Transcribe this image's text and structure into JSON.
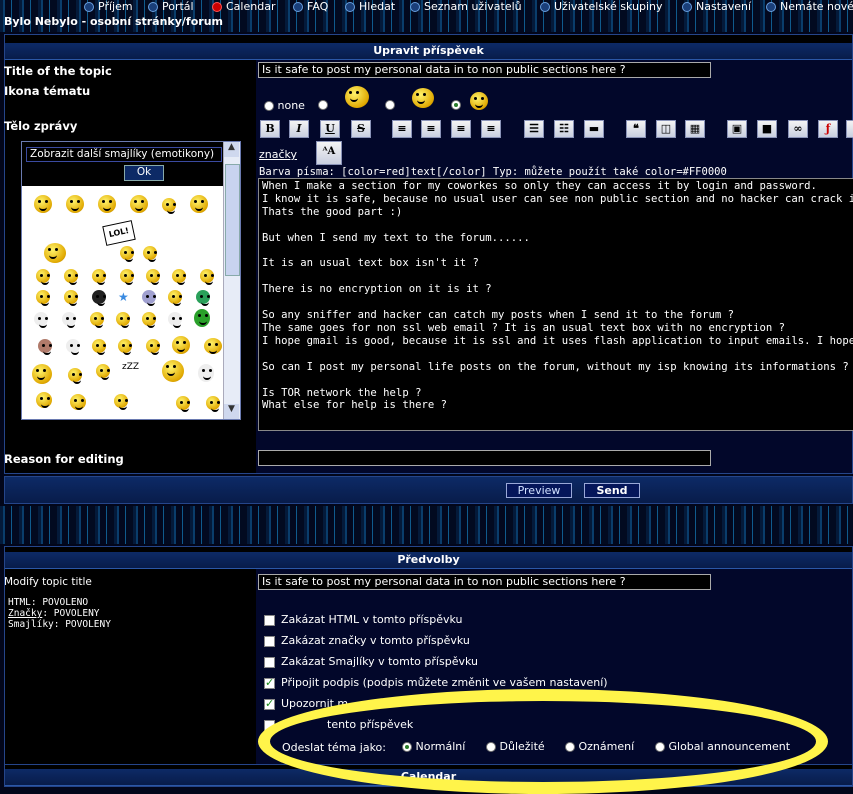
{
  "nav": {
    "items": [
      "Příjem",
      "Portál",
      "Calendar",
      "FAQ",
      "Hledat",
      "Seznam uživatelů",
      "Uživatelské skupiny",
      "Nastavení",
      "Nemáte nové"
    ]
  },
  "site_title": "Bylo Nebylo - osobní stránky/forum",
  "edit": {
    "header": "Upravit příspěvek",
    "title_label": "Title of the topic",
    "title_value": "Is it safe to post my personal data in to non public sections here ?",
    "icon_label": "Ikona tématu",
    "icon_none": "none",
    "body_label": "Tělo zprávy",
    "smilies_select": "Zobrazit další smajlíky (emotikony)",
    "smilies_ok": "Ok",
    "tags_link": "značky",
    "color_hint": "Barva písma: [color=red]text[/color] Typ: můžete použít také color=#FF0000",
    "message_text": "When I make a section for my coworkes so only they can access it by login and password.\nI know it is safe, because no usual user can see non public section and no hacker can crack it without m\nThats the good part :)\n\nBut when I send my text to the forum......\n\nIt is an usual text box isn't it ?\n\nThere is no encryption on it is it ?\n\nSo any sniffer and hacker can catch my posts when I send it to the forum ?\nThe same goes for non ssl web email ? It is an usual text box with no encryption ?\nI hope gmail is good, because it is ssl and it uses flash application to input emails. I hope it does not se\n\nSo can I post my personal life posts on the forum, without my isp knowing its informations ?\n\nIs TOR network the help ?\nWhat else for help is there ?",
    "reason_label": "Reason for editing",
    "reason_value": "",
    "preview_button": "Preview",
    "send_button": "Send"
  },
  "prefs": {
    "header": "Předvolby",
    "modify_label": "Modify topic title",
    "modify_value": "Is it safe to post my personal data in to non public sections here ?",
    "html_status": "HTML: POVOLENO",
    "tags_status_link": "Značky",
    "tags_status_value": ": POVOLENY",
    "smilies_status": "Smajlíky: POVOLENY",
    "options": [
      {
        "label": "Zakázat HTML v tomto příspěvku",
        "checked": false
      },
      {
        "label": "Zakázat značky v tomto příspěvku",
        "checked": false
      },
      {
        "label": "Zakázat Smajlíky v tomto příspěvku",
        "checked": false
      },
      {
        "label": "Připojit podpis (podpis můžete změnit ve vašem nastavení)",
        "checked": true
      },
      {
        "label": "Upozornit m",
        "checked": true
      },
      {
        "label": "tento příspěvek",
        "checked": false
      }
    ],
    "post_as_label": "Odeslat téma jako:",
    "post_as_options": [
      "Normální",
      "Důležité",
      "Oznámení",
      "Global announcement"
    ],
    "post_as_selected": "Normální"
  },
  "calendar_header": "Calendar",
  "colors": {
    "highlight": "#fff44a",
    "bar": "#0d2a66"
  }
}
